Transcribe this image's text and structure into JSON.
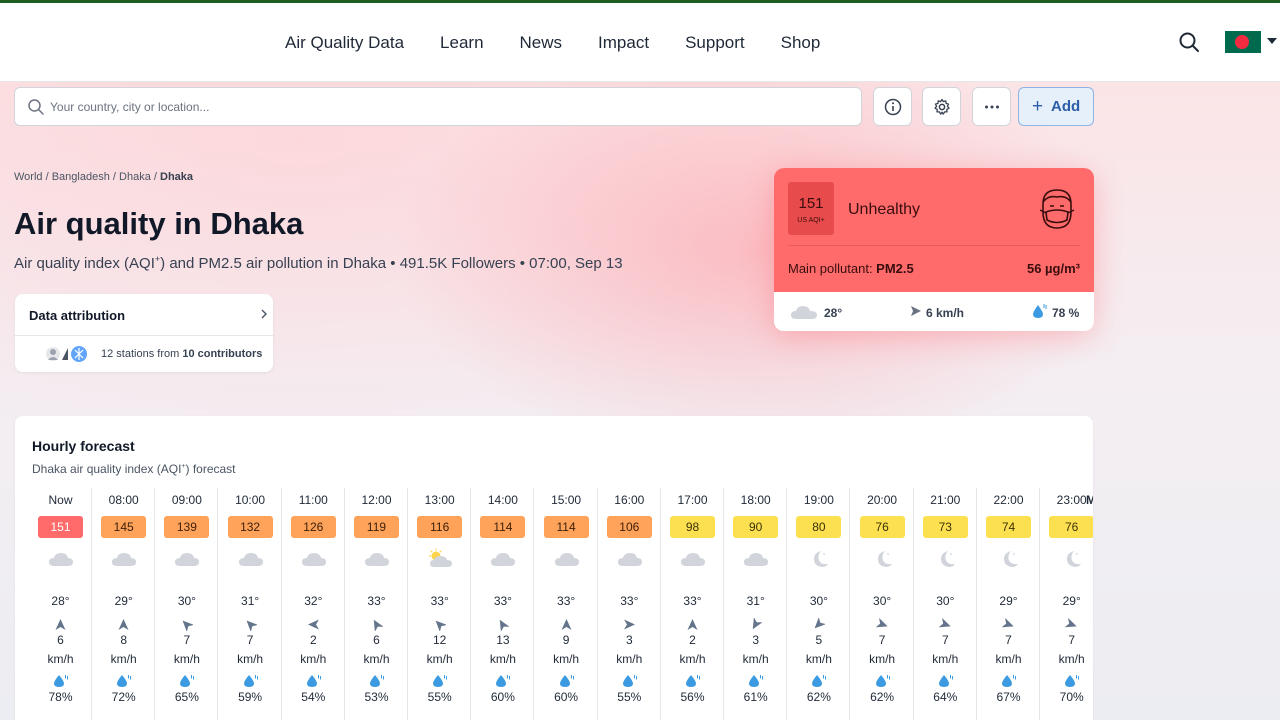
{
  "nav": {
    "items": [
      "Air Quality Data",
      "Learn",
      "News",
      "Impact",
      "Support",
      "Shop"
    ]
  },
  "search": {
    "placeholder": "Your country, city or location..."
  },
  "toolbar": {
    "add_label": "Add"
  },
  "breadcrumb": {
    "world": "World",
    "country": "Bangladesh",
    "region": "Dhaka",
    "city": "Dhaka",
    "sep": "/"
  },
  "page": {
    "title": "Air quality in Dhaka",
    "subtitle_pre": "Air quality index (AQI",
    "subtitle_sup": "+",
    "subtitle_post": ") and PM2.5 air pollution in Dhaka • 491.5K Followers • 07:00, Sep 13"
  },
  "attribution": {
    "title": "Data attribution",
    "stations_pre": "12 stations from ",
    "contributors": "10 contributors"
  },
  "current": {
    "aqi": "151",
    "aqi_unit": "US AQI+",
    "status": "Unhealthy",
    "pollutant_label": "Main pollutant: ",
    "pollutant": "PM2.5",
    "concentration": "56 µg/m³",
    "temp": "28°",
    "wind": "6 km/h",
    "humidity": "78 %",
    "status_color": "#ff6b6b"
  },
  "forecast": {
    "title": "Hourly forecast",
    "subtitle_pre": "Dhaka air quality index (AQI",
    "subtitle_sup": "+",
    "subtitle_post": ") forecast",
    "truncated_label": "M",
    "hours": [
      {
        "time": "Now",
        "aqi": "151",
        "level": "red",
        "icon": "cloud-icon",
        "temp": "28°",
        "dir": 90,
        "speed": "6",
        "unit": "km/h",
        "humidity": "78%"
      },
      {
        "time": "08:00",
        "aqi": "145",
        "level": "orange",
        "icon": "cloud-icon",
        "temp": "29°",
        "dir": 90,
        "speed": "8",
        "unit": "km/h",
        "humidity": "72%"
      },
      {
        "time": "09:00",
        "aqi": "139",
        "level": "orange",
        "icon": "cloud-icon",
        "temp": "30°",
        "dir": 45,
        "speed": "7",
        "unit": "km/h",
        "humidity": "65%"
      },
      {
        "time": "10:00",
        "aqi": "132",
        "level": "orange",
        "icon": "cloud-icon",
        "temp": "31°",
        "dir": 45,
        "speed": "7",
        "unit": "km/h",
        "humidity": "59%"
      },
      {
        "time": "11:00",
        "aqi": "126",
        "level": "orange",
        "icon": "cloud-icon",
        "temp": "32°",
        "dir": 0,
        "speed": "2",
        "unit": "km/h",
        "humidity": "54%"
      },
      {
        "time": "12:00",
        "aqi": "119",
        "level": "orange",
        "icon": "cloud-icon",
        "temp": "33°",
        "dir": 60,
        "speed": "6",
        "unit": "km/h",
        "humidity": "53%"
      },
      {
        "time": "13:00",
        "aqi": "116",
        "level": "orange",
        "icon": "sun-cloud-icon",
        "temp": "33°",
        "dir": 45,
        "speed": "12",
        "unit": "km/h",
        "humidity": "55%"
      },
      {
        "time": "14:00",
        "aqi": "114",
        "level": "orange",
        "icon": "cloud-icon",
        "temp": "33°",
        "dir": 60,
        "speed": "13",
        "unit": "km/h",
        "humidity": "60%"
      },
      {
        "time": "15:00",
        "aqi": "114",
        "level": "orange",
        "icon": "cloud-icon",
        "temp": "33°",
        "dir": 90,
        "speed": "9",
        "unit": "km/h",
        "humidity": "60%"
      },
      {
        "time": "16:00",
        "aqi": "106",
        "level": "orange",
        "icon": "cloud-icon",
        "temp": "33°",
        "dir": 180,
        "speed": "3",
        "unit": "km/h",
        "humidity": "55%"
      },
      {
        "time": "17:00",
        "aqi": "98",
        "level": "yellow",
        "icon": "cloud-icon",
        "temp": "33°",
        "dir": 90,
        "speed": "2",
        "unit": "km/h",
        "humidity": "56%"
      },
      {
        "time": "18:00",
        "aqi": "90",
        "level": "yellow",
        "icon": "cloud-icon",
        "temp": "31°",
        "dir": 300,
        "speed": "3",
        "unit": "km/h",
        "humidity": "61%"
      },
      {
        "time": "19:00",
        "aqi": "80",
        "level": "yellow",
        "icon": "moon-icon",
        "temp": "30°",
        "dir": 315,
        "speed": "5",
        "unit": "km/h",
        "humidity": "62%"
      },
      {
        "time": "20:00",
        "aqi": "76",
        "level": "yellow",
        "icon": "moon-icon",
        "temp": "30°",
        "dir": 200,
        "speed": "7",
        "unit": "km/h",
        "humidity": "62%"
      },
      {
        "time": "21:00",
        "aqi": "73",
        "level": "yellow",
        "icon": "moon-icon",
        "temp": "30°",
        "dir": 200,
        "speed": "7",
        "unit": "km/h",
        "humidity": "64%"
      },
      {
        "time": "22:00",
        "aqi": "74",
        "level": "yellow",
        "icon": "moon-icon",
        "temp": "29°",
        "dir": 200,
        "speed": "7",
        "unit": "km/h",
        "humidity": "67%"
      },
      {
        "time": "23:00",
        "aqi": "76",
        "level": "yellow",
        "icon": "moon-icon",
        "temp": "29°",
        "dir": 200,
        "speed": "7",
        "unit": "km/h",
        "humidity": "70%"
      }
    ]
  },
  "colors": {
    "red": "#ff6b6b",
    "orange": "#ffa25a",
    "yellow": "#fde04f",
    "accent": "#2d5da8"
  }
}
